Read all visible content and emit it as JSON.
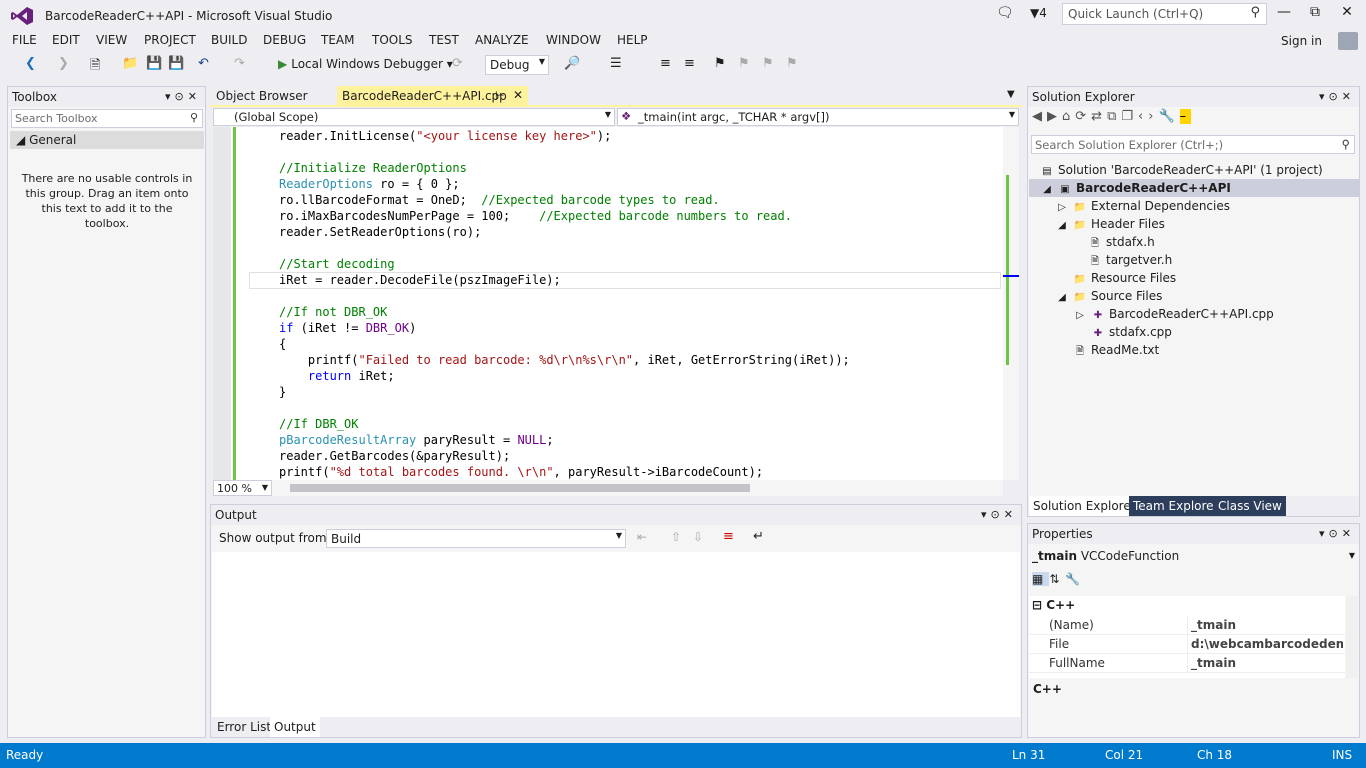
{
  "window": {
    "title": "BarcodeReaderC++API - Microsoft Visual Studio",
    "notification_count": "4",
    "quick_launch_placeholder": "Quick Launch (Ctrl+Q)"
  },
  "menu": [
    "FILE",
    "EDIT",
    "VIEW",
    "PROJECT",
    "BUILD",
    "DEBUG",
    "TEAM",
    "TOOLS",
    "TEST",
    "ANALYZE",
    "WINDOW",
    "HELP"
  ],
  "signin": "Sign in",
  "toolbar": {
    "debugger": "Local Windows Debugger",
    "config": "Debug"
  },
  "toolbox": {
    "title": "Toolbox",
    "search_placeholder": "Search Toolbox",
    "group": "General",
    "message": "There are no usable controls in this group. Drag an item onto this text to add it to the toolbox."
  },
  "editor": {
    "tabs": {
      "inactive": "Object Browser",
      "active": "BarcodeReaderC++API.cpp"
    },
    "scope": "(Global Scope)",
    "member": "_tmain(int argc, _TCHAR * argv[])",
    "zoom": "100 %",
    "lines": [
      "reader.InitLicense(\"<your license key here>\");",
      "",
      "//Initialize ReaderOptions",
      "ReaderOptions ro = { 0 };",
      "ro.llBarcodeFormat = OneD;  //Expected barcode types to read.",
      "ro.iMaxBarcodesNumPerPage = 100;    //Expected barcode numbers to read.",
      "reader.SetReaderOptions(ro);",
      "",
      "//Start decoding",
      "iRet = reader.DecodeFile(pszImageFile);",
      "",
      "//If not DBR_OK",
      "if (iRet != DBR_OK)",
      "{",
      "    printf(\"Failed to read barcode: %d\\r\\n%s\\r\\n\", iRet, GetErrorString(iRet));",
      "    return iRet;",
      "}",
      "",
      "//If DBR_OK",
      "pBarcodeResultArray paryResult = NULL;",
      "reader.GetBarcodes(&paryResult);",
      "printf(\"%d total barcodes found. \\r\\n\", paryResult->iBarcodeCount);"
    ]
  },
  "output": {
    "title": "Output",
    "show_from_label": "Show output from:",
    "source": "Build",
    "tabs": [
      "Error List",
      "Output"
    ]
  },
  "solution_explorer": {
    "title": "Solution Explorer",
    "search_placeholder": "Search Solution Explorer (Ctrl+;)",
    "items": [
      {
        "label": "Solution 'BarcodeReaderC++API' (1 project)"
      },
      {
        "label": "BarcodeReaderC++API"
      },
      {
        "label": "External Dependencies"
      },
      {
        "label": "Header Files"
      },
      {
        "label": "stdafx.h"
      },
      {
        "label": "targetver.h"
      },
      {
        "label": "Resource Files"
      },
      {
        "label": "Source Files"
      },
      {
        "label": "BarcodeReaderC++API.cpp"
      },
      {
        "label": "stdafx.cpp"
      },
      {
        "label": "ReadMe.txt"
      }
    ],
    "tabs": [
      "Solution Explorer",
      "Team Explorer",
      "Class View"
    ]
  },
  "properties": {
    "title": "Properties",
    "object_name": "_tmain",
    "object_type": "VCCodeFunction",
    "category": "C++",
    "rows": [
      {
        "key": "(Name)",
        "value": "_tmain"
      },
      {
        "key": "File",
        "value": "d:\\webcambarcodedemo\\b"
      },
      {
        "key": "FullName",
        "value": "_tmain"
      }
    ],
    "description": "C++"
  },
  "status": {
    "state": "Ready",
    "line": "Ln 31",
    "col": "Col 21",
    "ch": "Ch 18",
    "mode": "INS"
  },
  "colors": {
    "accent": "#007acc",
    "active_tab": "#fff29d",
    "change_bar": "#6cc644"
  }
}
